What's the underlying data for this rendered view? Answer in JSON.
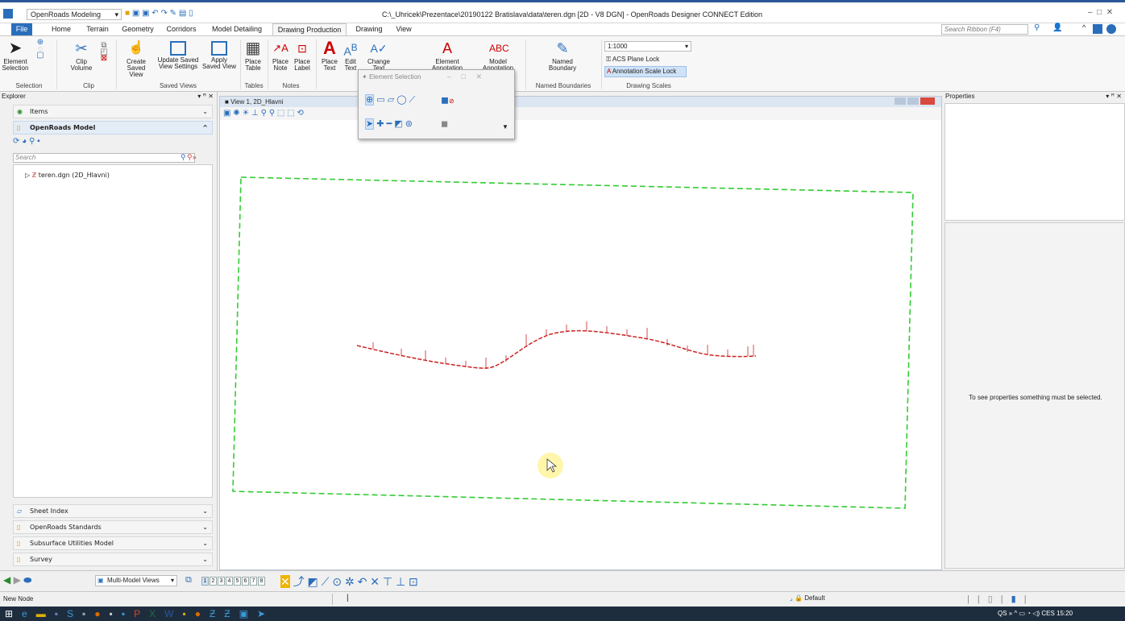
{
  "titlebar": {
    "workflow": "OpenRoads Modeling",
    "title": "C:\\_Uhricek\\Prezentace\\20190122 Bratislava\\data\\teren.dgn [2D - V8 DGN] - OpenRoads Designer CONNECT Edition",
    "search_placeholder": "Search Ribbon (F4)"
  },
  "tabs": [
    "File",
    "Home",
    "Terrain",
    "Geometry",
    "Corridors",
    "Model Detailing",
    "Drawing Production",
    "Drawing",
    "View"
  ],
  "ribbon": {
    "element_selection": "Element Selection",
    "clip_volume": "Clip Volume",
    "create_saved_view": "Create Saved View",
    "update_saved_view": "Update Saved View Settings",
    "apply_saved_view": "Apply Saved View",
    "place_table": "Place Table",
    "place_note": "Place Note",
    "place_label": "Place Label",
    "place_text": "Place Text",
    "edit_text": "Edit Text",
    "change_text": "Change Text",
    "element_annotation": "Element Annotation",
    "model_annotation": "Model Annotation",
    "named_boundary": "Named Boundary",
    "scale_value": "1:1000",
    "acs_plane_lock": "ACS Plane Lock",
    "annotation_scale_lock": "Annotation Scale Lock",
    "groups": {
      "selection": "Selection",
      "clip": "Clip",
      "saved_views": "Saved Views",
      "tables": "Tables",
      "notes": "Notes",
      "named_boundaries": "Named Boundaries",
      "drawing_scales": "Drawing Scales"
    }
  },
  "explorer": {
    "title": "Explorer",
    "items": "Items",
    "openroads_model": "OpenRoads Model",
    "search_placeholder": "Search",
    "tree_item": "teren.dgn (2D_Hlavni)",
    "sections": [
      "Sheet Index",
      "OpenRoads Standards",
      "Subsurface Utilities Model",
      "Survey"
    ]
  },
  "view": {
    "title": "View 1, 2D_Hlavni"
  },
  "dialog": {
    "title": "Element Selection"
  },
  "properties": {
    "title": "Properties",
    "empty_message": "To see properties something must be selected."
  },
  "bottom": {
    "multi_model": "Multi-Model Views",
    "view_numbers": [
      "1",
      "2",
      "3",
      "4",
      "5",
      "6",
      "7",
      "8"
    ]
  },
  "status": {
    "message": "New Node",
    "level": "Default"
  },
  "taskbar": {
    "lang": "CES",
    "time": "15:20",
    "tray_text": "QS"
  },
  "colors": {
    "accent": "#2a6ebb",
    "boundary": "#33cc33",
    "alignment": "#cc2222",
    "highlight": "#fff59d"
  }
}
